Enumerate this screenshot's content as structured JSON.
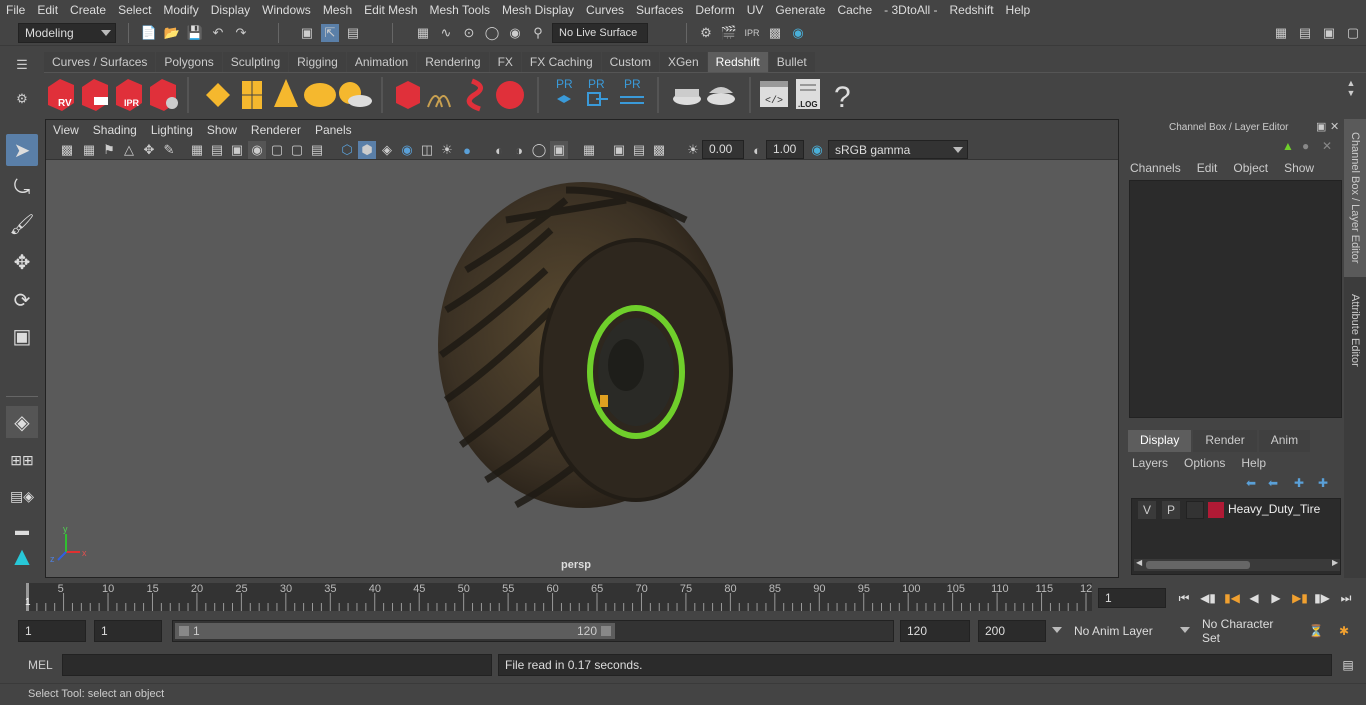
{
  "menubar": {
    "items": [
      "File",
      "Edit",
      "Create",
      "Select",
      "Modify",
      "Display",
      "Windows",
      "Mesh",
      "Edit Mesh",
      "Mesh Tools",
      "Mesh Display",
      "Curves",
      "Surfaces",
      "Deform",
      "UV",
      "Generate",
      "Cache",
      "- 3DtoAll -",
      "Redshift",
      "Help"
    ]
  },
  "status": {
    "workspace": "Modeling",
    "live_surface": "No Live Surface"
  },
  "shelf": {
    "tabs": [
      "Curves / Surfaces",
      "Polygons",
      "Sculpting",
      "Rigging",
      "Animation",
      "Rendering",
      "FX",
      "FX Caching",
      "Custom",
      "XGen",
      "Redshift",
      "Bullet"
    ],
    "active_tab": "Redshift",
    "rv_label": "RV",
    "ipr_label": "IPR",
    "pr_label": "PR",
    "log_label": ".LOG",
    "help_glyph": "?"
  },
  "viewport": {
    "menu": [
      "View",
      "Shading",
      "Lighting",
      "Show",
      "Renderer",
      "Panels"
    ],
    "exposure": "0.00",
    "gamma": "1.00",
    "color_space": "sRGB gamma",
    "camera_label": "persp",
    "axis": {
      "x": "x",
      "y": "y",
      "z": "z"
    }
  },
  "channel_box": {
    "title": "Channel Box / Layer Editor",
    "menu": [
      "Channels",
      "Edit",
      "Object",
      "Show"
    ]
  },
  "layer_editor": {
    "tabs": [
      "Display",
      "Render",
      "Anim"
    ],
    "active_tab": "Display",
    "menu": [
      "Layers",
      "Options",
      "Help"
    ],
    "layer": {
      "v": "V",
      "p": "P",
      "name": "Heavy_Duty_Tire",
      "color": "#b01a35"
    }
  },
  "side_tabs": [
    "Channel Box / Layer Editor",
    "Attribute Editor"
  ],
  "timeline": {
    "ticks": [
      "5",
      "10",
      "15",
      "20",
      "25",
      "30",
      "35",
      "40",
      "45",
      "50",
      "55",
      "60",
      "65",
      "70",
      "75",
      "80",
      "85",
      "90",
      "95",
      "100",
      "105",
      "110",
      "115",
      "12"
    ],
    "current_marker": "1",
    "current_frame": "1"
  },
  "range": {
    "start": "1",
    "playback_start": "1",
    "slider_start": "1",
    "slider_end": "120",
    "playback_end": "120",
    "end": "200",
    "anim_layer": "No Anim Layer",
    "character_set": "No Character Set"
  },
  "command": {
    "lang": "MEL",
    "result": "File read in  0.17 seconds."
  },
  "help_line": "Select Tool: select an object",
  "colors": {
    "accent": "#5d5d5d",
    "rim": "#6fcf2b",
    "redshift_red": "#e0303a",
    "yellow": "#f5b82e",
    "blue": "#3a9ad9"
  }
}
